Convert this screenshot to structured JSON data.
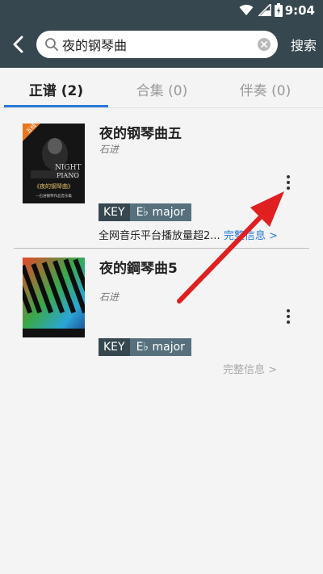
{
  "status": {
    "time": "9:04"
  },
  "search": {
    "value": "夜的钢琴曲",
    "button": "搜索"
  },
  "tabs": [
    {
      "label": "正谱 (2)",
      "active": true
    },
    {
      "label": "合集 (0)",
      "active": false
    },
    {
      "label": "伴奏 (0)",
      "active": false
    }
  ],
  "results": [
    {
      "title": "夜的钢琴曲五",
      "composer": "石进",
      "key_label": "KEY",
      "key_value": "E♭ major",
      "desc": "全网音乐平台播放量超2...",
      "info": "完整信息 >",
      "cover": {
        "badge": "五线",
        "line1": "NIGHT",
        "line2": "PIANO",
        "line3": "《夜的钢琴曲》",
        "line4": "—石进钢琴作品音乐集"
      }
    },
    {
      "title": "夜的鋼琴曲5",
      "composer": "石进",
      "key_label": "KEY",
      "key_value": "E♭ major",
      "info": "完整信息 >"
    }
  ],
  "colors": {
    "header": "#36474f",
    "accent": "#2a7bd6",
    "annotation": "#e02020"
  }
}
